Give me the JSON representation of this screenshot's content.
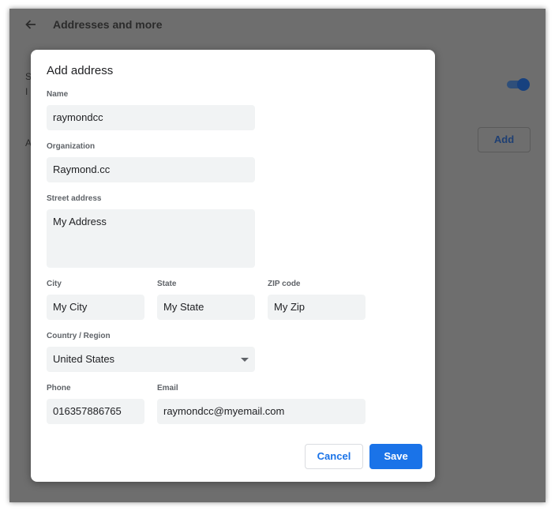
{
  "page": {
    "title": "Addresses and more",
    "add_label": "Add",
    "fragment_s": "S",
    "fragment_i": "I",
    "fragment_a": "A"
  },
  "dialog": {
    "title": "Add address",
    "name": {
      "label": "Name",
      "value": "raymondcc"
    },
    "organization": {
      "label": "Organization",
      "value": "Raymond.cc"
    },
    "street": {
      "label": "Street address",
      "value": "My Address"
    },
    "city": {
      "label": "City",
      "value": "My City"
    },
    "state": {
      "label": "State",
      "value": "My State"
    },
    "zip": {
      "label": "ZIP code",
      "value": "My Zip"
    },
    "country": {
      "label": "Country / Region",
      "value": "United States"
    },
    "phone": {
      "label": "Phone",
      "value": "016357886765"
    },
    "email": {
      "label": "Email",
      "value": "raymondcc@myemail.com"
    },
    "cancel_label": "Cancel",
    "save_label": "Save"
  },
  "icons": {
    "back": "arrow-left-icon",
    "dropdown": "chevron-down-icon"
  },
  "colors": {
    "accent": "#1a73e8",
    "overlay": "#6e6e6e",
    "field_bg": "#f1f3f4"
  }
}
